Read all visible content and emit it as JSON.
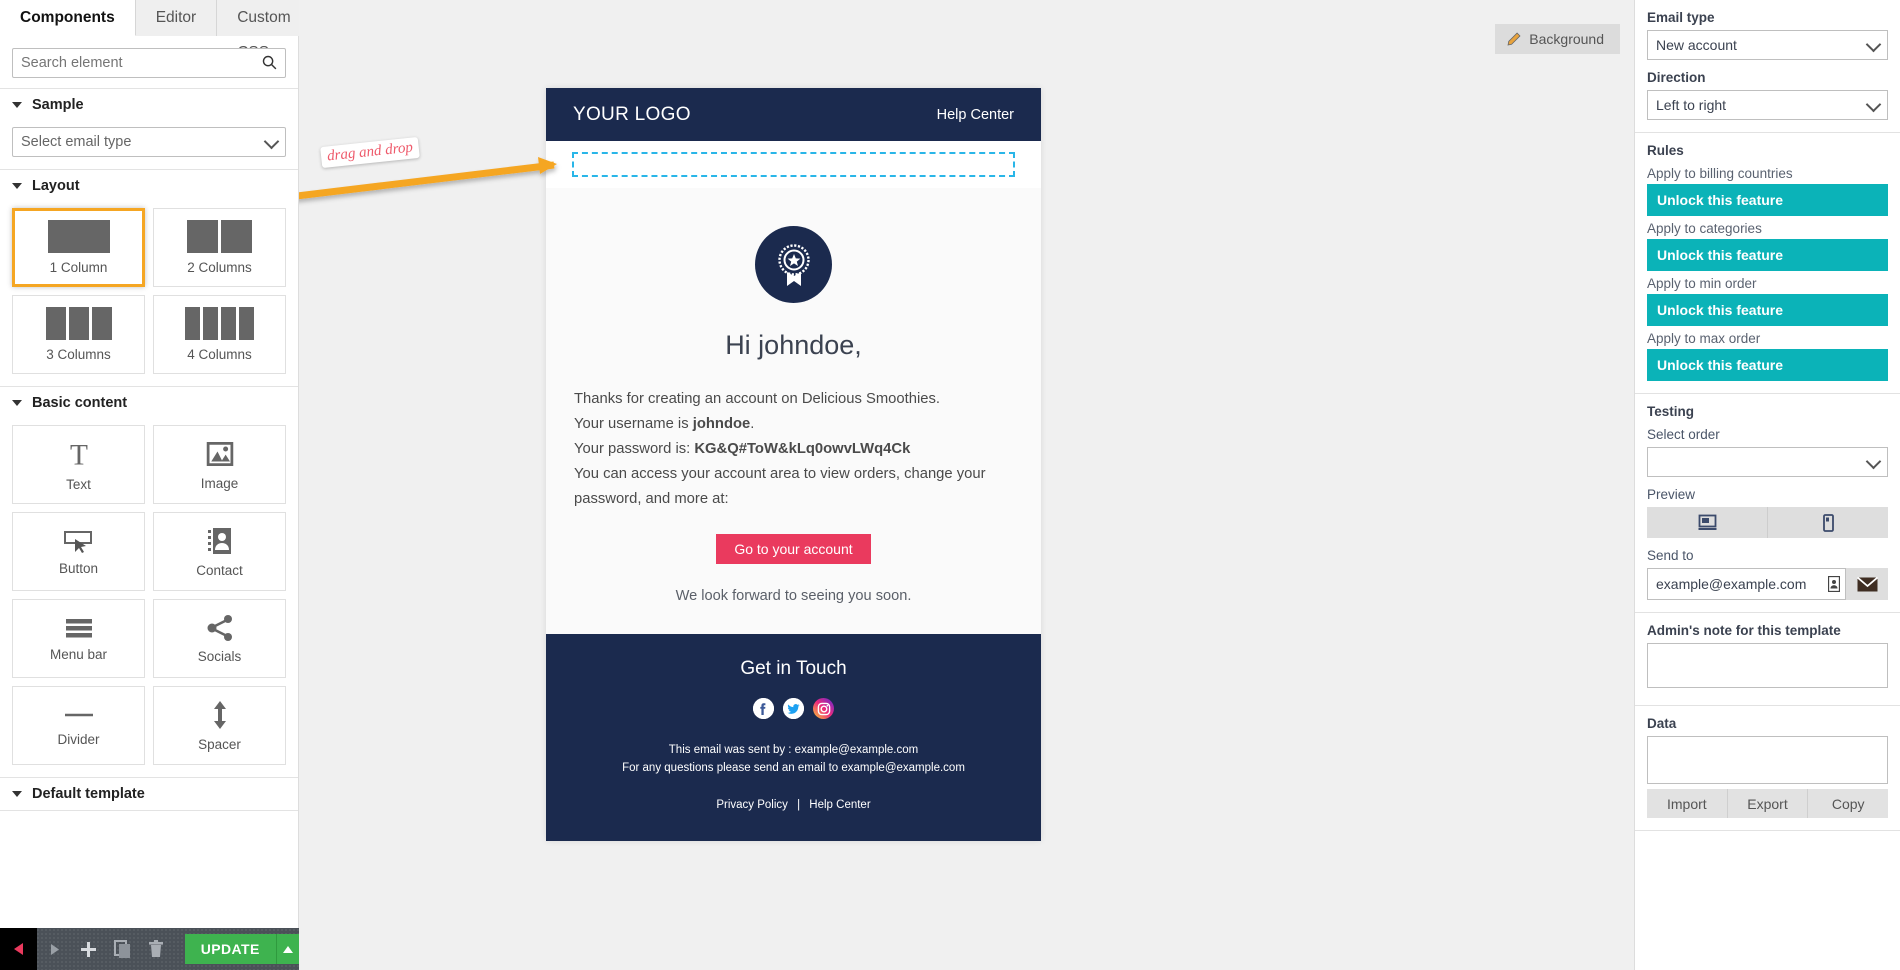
{
  "left_panel": {
    "tabs": [
      {
        "label": "Components",
        "active": true
      },
      {
        "label": "Editor",
        "active": false
      },
      {
        "label": "Custom CSS",
        "active": false
      }
    ],
    "search_placeholder": "Search element",
    "sections": {
      "sample": {
        "title": "Sample",
        "select_placeholder": "Select email type"
      },
      "layout": {
        "title": "Layout",
        "items": [
          {
            "label": "1 Column",
            "cols": 1,
            "selected": true
          },
          {
            "label": "2 Columns",
            "cols": 2,
            "selected": false
          },
          {
            "label": "3 Columns",
            "cols": 3,
            "selected": false
          },
          {
            "label": "4 Columns",
            "cols": 4,
            "selected": false
          }
        ]
      },
      "basic_content": {
        "title": "Basic content",
        "items": [
          {
            "label": "Text",
            "icon": "text-icon"
          },
          {
            "label": "Image",
            "icon": "image-icon"
          },
          {
            "label": "Button",
            "icon": "button-icon"
          },
          {
            "label": "Contact",
            "icon": "contact-icon"
          },
          {
            "label": "Menu bar",
            "icon": "menu-bar-icon"
          },
          {
            "label": "Socials",
            "icon": "share-icon"
          },
          {
            "label": "Divider",
            "icon": "divider-icon"
          },
          {
            "label": "Spacer",
            "icon": "spacer-icon"
          }
        ]
      },
      "default_template": {
        "title": "Default template"
      }
    },
    "bottom_bar": {
      "back_icon": "back-triangle-icon",
      "tools": [
        "play-icon",
        "plus-icon",
        "duplicate-icon",
        "trash-icon"
      ],
      "update_label": "UPDATE",
      "update_caret_icon": "caret-up-icon"
    }
  },
  "canvas": {
    "background_button": {
      "label": "Background",
      "icon": "pencil-icon"
    },
    "annotation": {
      "text": "drag and drop",
      "color": "#ee5a6b",
      "arrow_color": "#f5a623"
    },
    "email": {
      "header": {
        "logo": "YOUR LOGO",
        "help": "Help Center",
        "bg": "#1b2a4e"
      },
      "dropzone": {
        "border_color": "#29b6e8"
      },
      "badge_icon": "award-ribbon-icon",
      "greeting": "Hi johndoe,",
      "lines": [
        {
          "text": "Thanks for creating an account on Delicious Smoothies."
        },
        {
          "prefix": "Your username is ",
          "bold": "johndoe",
          "suffix": "."
        },
        {
          "prefix": "Your password is: ",
          "bold": "KG&Q#ToW&kLq0owvLWq4Ck",
          "suffix": ""
        },
        {
          "text": "You can access your account area to view orders, change your password, and more at:"
        }
      ],
      "cta": {
        "label": "Go to your account",
        "color": "#ea3a5e"
      },
      "closing": "We look forward to seeing you soon.",
      "footer": {
        "title": "Get in Touch",
        "socials": [
          "facebook-icon",
          "twitter-icon",
          "instagram-icon"
        ],
        "sent_by": "This email was sent by : example@example.com",
        "questions": "For any questions please send an email to example@example.com",
        "link_privacy": "Privacy Policy",
        "link_sep": "|",
        "link_help": "Help Center"
      }
    }
  },
  "right_panel": {
    "email_type": {
      "label": "Email type",
      "value": "New account"
    },
    "direction": {
      "label": "Direction",
      "value": "Left to right"
    },
    "rules": {
      "title": "Rules",
      "accent": "#0bb3b8",
      "items": [
        {
          "label": "Apply to billing countries",
          "button": "Unlock this feature"
        },
        {
          "label": "Apply to categories",
          "button": "Unlock this feature"
        },
        {
          "label": "Apply to min order",
          "button": "Unlock this feature"
        },
        {
          "label": "Apply to max order",
          "button": "Unlock this feature"
        }
      ]
    },
    "testing": {
      "title": "Testing",
      "select_order_label": "Select order",
      "select_order_value": "",
      "preview_label": "Preview",
      "preview_buttons": [
        "desktop-icon",
        "mobile-icon"
      ],
      "send_to_label": "Send to",
      "send_to_value": "example@example.com",
      "send_icon": "envelope-icon"
    },
    "admin_note": {
      "label": "Admin's note for this template",
      "value": ""
    },
    "data": {
      "label": "Data",
      "value": "",
      "buttons": [
        "Import",
        "Export",
        "Copy"
      ]
    }
  }
}
